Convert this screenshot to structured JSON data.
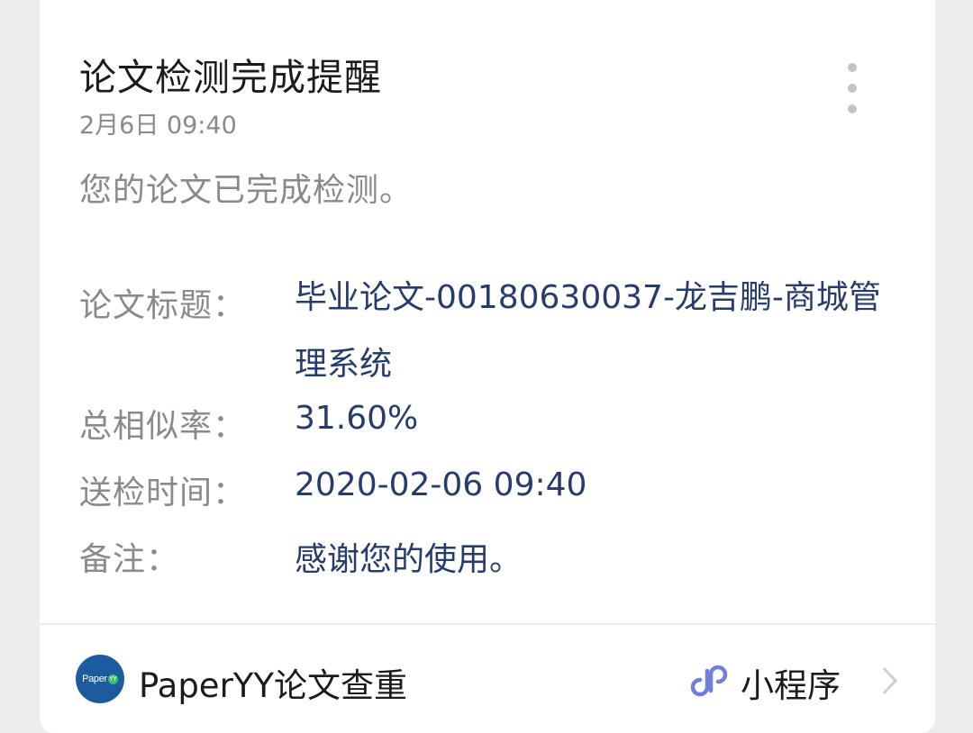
{
  "notification": {
    "title": "论文检测完成提醒",
    "timestamp": "2月6日  09:40",
    "summary": "您的论文已完成检测。"
  },
  "details": [
    {
      "label": "论文标题：",
      "value": "毕业论文-00180630037-龙吉鹏-商城管理系统"
    },
    {
      "label": "总相似率：",
      "value": "31.60%"
    },
    {
      "label": "送检时间：",
      "value": "2020-02-06 09:40"
    },
    {
      "label": "备注：",
      "value": "感谢您的使用。"
    }
  ],
  "footer": {
    "source_name": "PaperYY论文查重",
    "logo_text": "Paper",
    "logo_badge": "YY",
    "mini_program_label": "小程序",
    "mini_program_icon": "mini-program-link-icon",
    "chevron_icon": "chevron-right-icon"
  },
  "colors": {
    "background": "#ededed",
    "card": "#ffffff",
    "value_text": "#263c6d",
    "muted_text": "#8a8a8a",
    "logo_blue": "#1c5b9e",
    "mini_program_icon": "#6f7fdb"
  }
}
